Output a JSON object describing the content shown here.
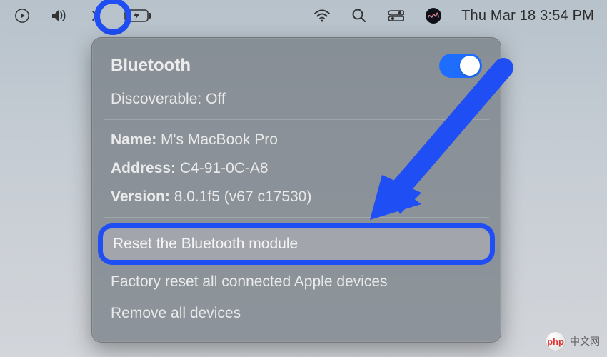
{
  "menubar": {
    "icons": {
      "play": "play-circle-icon",
      "sound": "volume-icon",
      "bluetooth": "bluetooth-icon",
      "battery": "battery-charging-icon",
      "wifi": "wifi-icon",
      "search": "search-icon",
      "control": "control-center-icon",
      "siri": "siri-icon"
    },
    "datetime": "Thu Mar 18  3:54 PM"
  },
  "panel": {
    "title": "Bluetooth",
    "toggle_on": true,
    "discoverable_label": "Discoverable:",
    "discoverable_value": "Off",
    "info": {
      "name_label": "Name:",
      "name_value": "M's MacBook Pro",
      "address_label": "Address:",
      "address_value": "C4-91-0C-A8",
      "version_label": "Version:",
      "version_value": "8.0.1f5 (v67 c17530)"
    },
    "actions": {
      "reset": "Reset the Bluetooth module",
      "factory_reset": "Factory reset all connected Apple devices",
      "remove_all": "Remove all devices"
    }
  },
  "annotation": {
    "arrow_color": "#1f4ef5"
  },
  "watermark": {
    "text": "中文网",
    "logo": "php"
  }
}
